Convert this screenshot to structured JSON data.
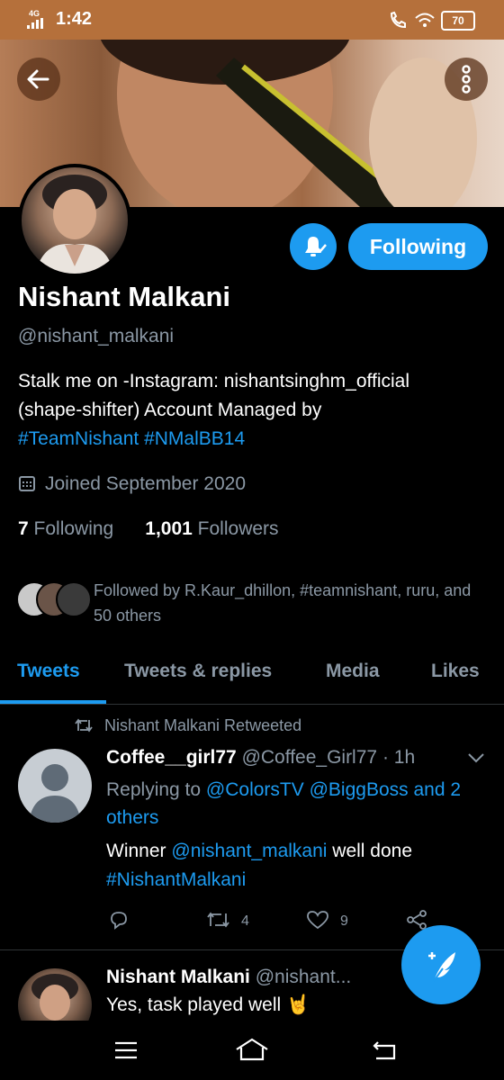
{
  "status_bar": {
    "network": "4G",
    "time": "1:42",
    "battery": "70",
    "icons": [
      "signal-icon",
      "call-icon",
      "wifi-icon",
      "battery-icon"
    ]
  },
  "header": {
    "icons": [
      "back-arrow-icon",
      "more-vertical-icon"
    ]
  },
  "profile": {
    "name": "Nishant Malkani",
    "handle": "@nishant_malkani",
    "bio_line1": "Stalk me on -Instagram: nishantsinghm_official",
    "bio_line2": "(shape-shifter) Account Managed by",
    "bio_tag1": "#TeamNishant",
    "bio_tag2": "#NMalBB14",
    "joined": "Joined September 2020",
    "following_count": "7",
    "following_label": "Following",
    "followers_count": "1,001",
    "followers_label": "Followers",
    "followed_by": "Followed by R.Kaur_dhillon, #teamnishant, ruru, and 50 others",
    "following_button": "Following"
  },
  "tabs": [
    {
      "label": "Tweets",
      "active": true
    },
    {
      "label": "Tweets & replies",
      "active": false
    },
    {
      "label": "Media",
      "active": false
    },
    {
      "label": "Likes",
      "active": false
    }
  ],
  "tweets": [
    {
      "retweet_label": "Nishant Malkani Retweeted",
      "name": "Coffee__girl77",
      "handle": "@Coffee_Girl77",
      "separator": "·",
      "time": "1h",
      "replying_prefix": "Replying to",
      "replying_to1": "@ColorsTV",
      "replying_to2": "@BiggBoss",
      "replying_others": "and 2 others",
      "text_prefix": "Winner",
      "text_mention": "@nishant_malkani",
      "text_suffix": "well done",
      "text_tag": "#NishantMalkani",
      "retweets": "4",
      "likes": "9"
    },
    {
      "name": "Nishant Malkani",
      "handle": "@nishant...",
      "text": "Yes, task played well 🤘"
    }
  ],
  "colors": {
    "accent": "#1d9bf0",
    "status_bar": "#b5703b",
    "muted_text": "#8b98a5",
    "background": "#000000"
  }
}
